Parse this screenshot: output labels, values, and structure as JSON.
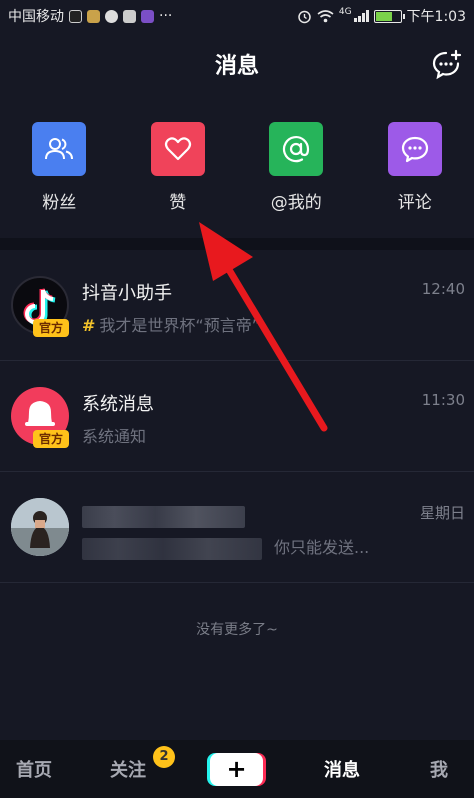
{
  "status_bar": {
    "carrier": "中国移动",
    "more": "···",
    "network": "4G",
    "time": "下午1:03"
  },
  "header": {
    "title": "消息"
  },
  "shortcuts": [
    {
      "label": "粉丝",
      "icon": "fans-icon",
      "color": "#4a7ff0"
    },
    {
      "label": "赞",
      "icon": "heart-icon",
      "color": "#f0435a"
    },
    {
      "label": "@我的",
      "icon": "at-icon",
      "color": "#26b45a"
    },
    {
      "label": "评论",
      "icon": "comment-icon",
      "color": "#9d5ae8"
    }
  ],
  "messages": [
    {
      "title": "抖音小助手",
      "subtitle": "我才是世界杯“预言帝”",
      "time": "12:40",
      "badge": "官方",
      "hash": "#"
    },
    {
      "title": "系统消息",
      "subtitle": "系统通知",
      "time": "11:30",
      "badge": "官方"
    },
    {
      "title": "",
      "subtitle": "你只能发送...",
      "time": "星期日"
    }
  ],
  "end_note": "没有更多了~",
  "bottom_nav": {
    "home": "首页",
    "follow": "关注",
    "follow_badge": "2",
    "plus": "+",
    "messages": "消息",
    "me": "我"
  },
  "colors": {
    "background": "#161824",
    "accent_yellow": "#ffc21a",
    "red_arrow": "#e8191e"
  }
}
